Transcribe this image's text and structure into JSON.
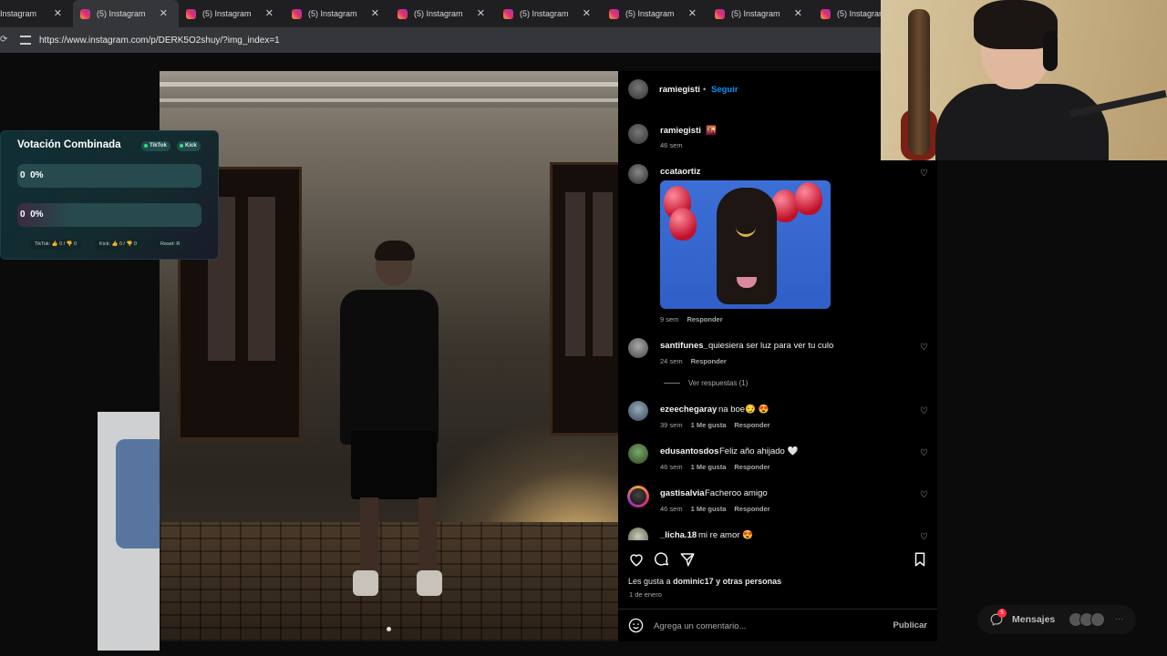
{
  "browser": {
    "tabs": [
      {
        "label": "Instagram",
        "active": false
      },
      {
        "label": "(5) Instagram",
        "active": true
      },
      {
        "label": "(5) Instagram",
        "active": false
      },
      {
        "label": "(5) Instagram",
        "active": false
      },
      {
        "label": "(5) Instagram",
        "active": false
      },
      {
        "label": "(5) Instagram",
        "active": false
      },
      {
        "label": "(5) Instagram",
        "active": false
      },
      {
        "label": "(5) Instagram",
        "active": false
      },
      {
        "label": "(5) Instagram",
        "active": false
      }
    ],
    "url": "https://www.instagram.com/p/DERK5O2shuy/?img_index=1"
  },
  "vote_widget": {
    "title": "Votación Combinada",
    "badge_tiktok": "TikTok",
    "badge_kick": "Kick",
    "option_a": {
      "count": "0",
      "percent": "0%"
    },
    "option_b": {
      "count": "0",
      "percent": "0%"
    },
    "footer_tiktok": "TikTok: 👍 0 / 👎 0",
    "footer_kick": "Kick: 👍 0 / 👎 0",
    "footer_reset": "Reset: R"
  },
  "post": {
    "author": "ramiegisti",
    "separator": "•",
    "follow_label": "Seguir",
    "caption_user": "ramiegisti",
    "caption_text": "🌇",
    "caption_time": "46 sem",
    "likes_prefix": "Les gusta a",
    "likes_user": "dominic17",
    "likes_suffix": "y otras personas",
    "date": "1 de enero"
  },
  "comments": [
    {
      "user": "ccataortiz",
      "text": "",
      "time": "9 sem",
      "likes": "",
      "reply": "Responder",
      "gif": true
    },
    {
      "user": "santifunes_",
      "text": "quiesiera ser luz para ver tu culo",
      "time": "24 sem",
      "likes": "",
      "reply": "Responder"
    },
    {
      "user": "ezeechegaray",
      "text": "na boe😏 😍",
      "time": "39 sem",
      "likes": "1 Me gusta",
      "reply": "Responder"
    },
    {
      "user": "edusantosdos",
      "text": "Feliz año ahijado 🤍",
      "time": "46 sem",
      "likes": "1 Me gusta",
      "reply": "Responder"
    },
    {
      "user": "gastisalvia",
      "text": "Facheroo amigo",
      "time": "46 sem",
      "likes": "1 Me gusta",
      "reply": "Responder"
    },
    {
      "user": "_licha.18",
      "text": "mi re amor 😍",
      "time": "",
      "likes": "",
      "reply": ""
    }
  ],
  "view_replies": "Ver respuestas (1)",
  "composer": {
    "placeholder": "Agrega un comentario...",
    "publish_label": "Publicar"
  },
  "messages": {
    "label": "Mensajes",
    "badge": "5",
    "more": "···"
  },
  "colors": {
    "follow": "#0095f6",
    "vote_accent": "#30e07b"
  }
}
